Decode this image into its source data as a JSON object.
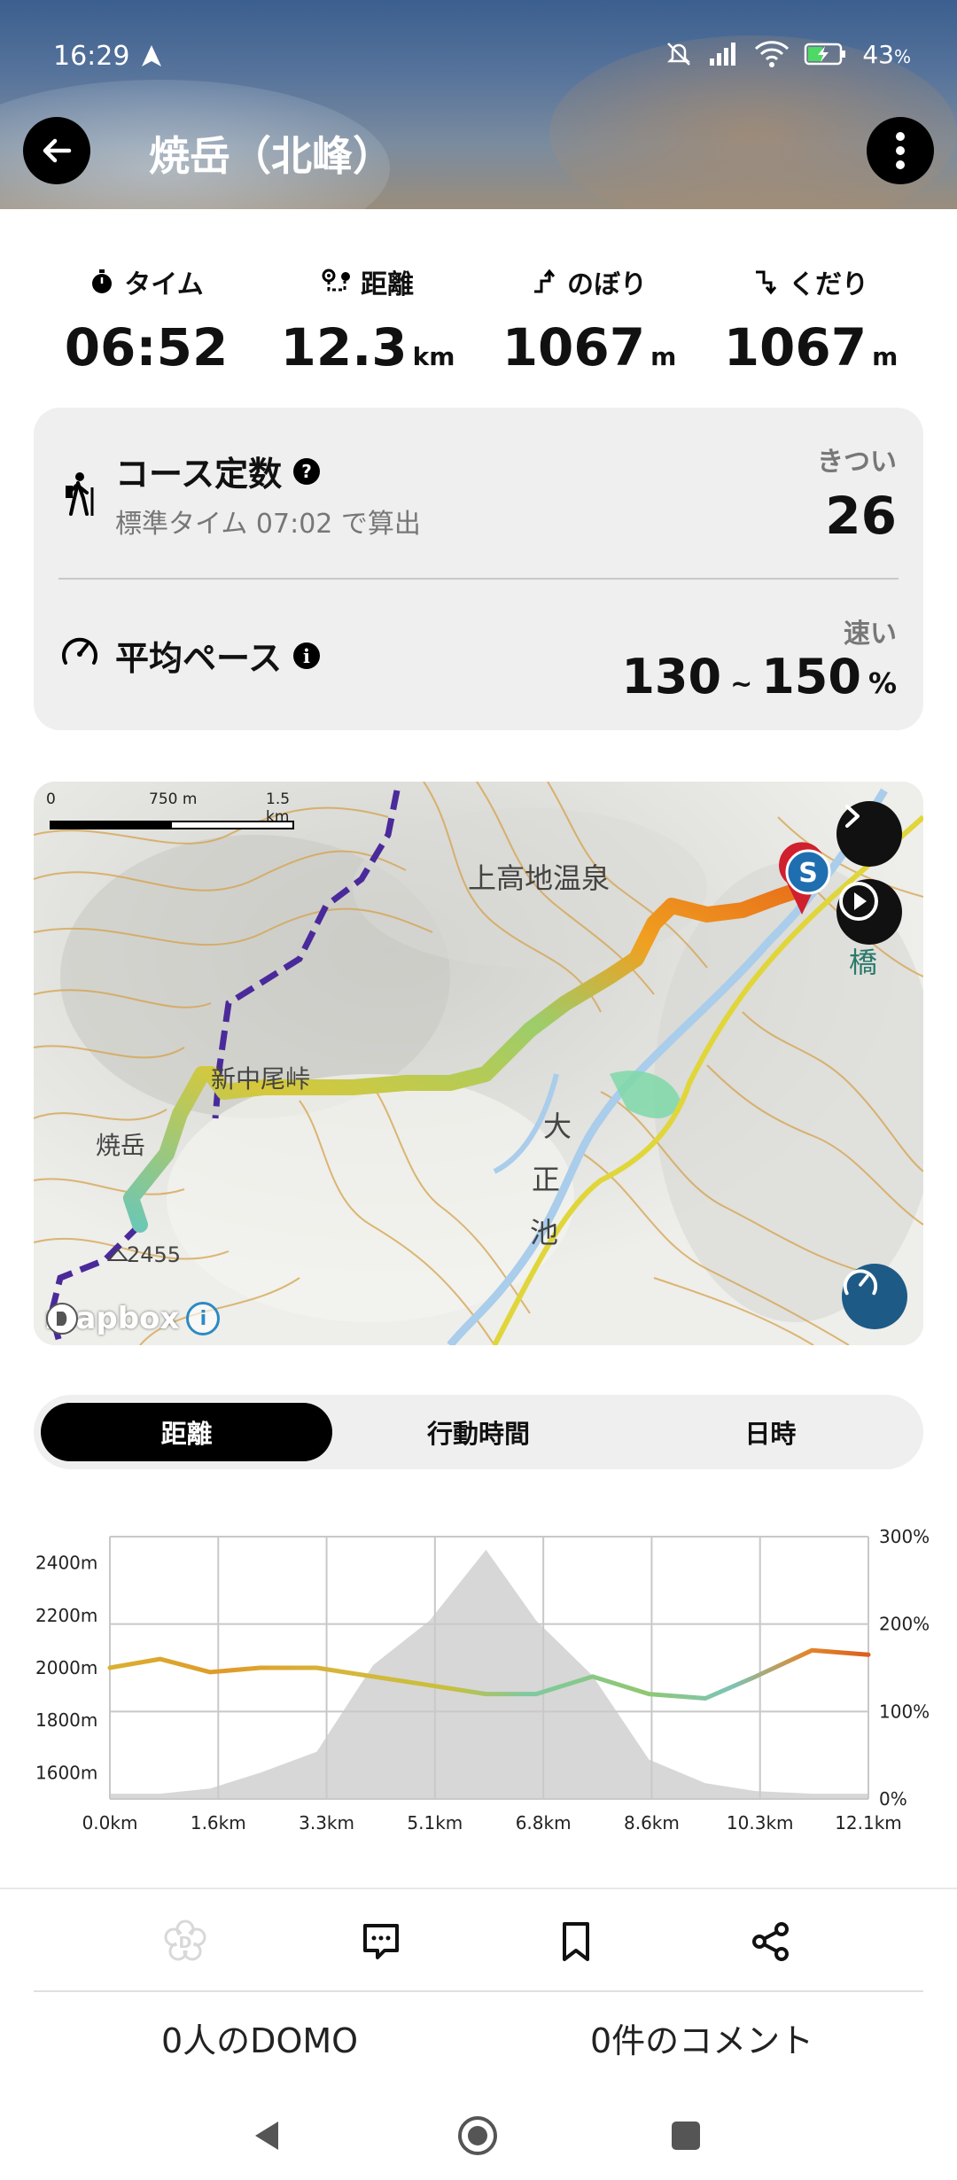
{
  "status_bar": {
    "time": "16:29",
    "battery": "43",
    "battery_unit": "%",
    "icons": [
      "navigation-arrow-icon",
      "mute-icon",
      "signal-icon",
      "wifi-icon",
      "battery-charging-icon"
    ]
  },
  "header": {
    "title": "焼岳（北峰）",
    "back_icon": "arrow-left-icon",
    "menu_icon": "more-vertical-icon"
  },
  "stats": [
    {
      "label": "タイム",
      "value": "06:52",
      "unit": "",
      "icon": "stopwatch-icon"
    },
    {
      "label": "距離",
      "value": "12.3",
      "unit": "km",
      "icon": "route-icon"
    },
    {
      "label": "のぼり",
      "value": "1067",
      "unit": "m",
      "icon": "ascent-icon"
    },
    {
      "label": "くだり",
      "value": "1067",
      "unit": "m",
      "icon": "descent-icon"
    }
  ],
  "course": {
    "title": "コース定数",
    "subtitle": "標準タイム 07:02 で算出",
    "level": "きつい",
    "value": "26",
    "icon": "hiker-icon"
  },
  "pace": {
    "title": "平均ペース",
    "speed_label": "速い",
    "min": "130",
    "separator": "~",
    "max": "150",
    "unit": "%",
    "icon": "speedometer-icon"
  },
  "map": {
    "scale_labels": [
      "0",
      "750 m",
      "1.5 km"
    ],
    "place_labels": [
      "上高地温泉",
      "新中尾峠",
      "焼岳",
      "2455",
      "大",
      "正",
      "池",
      "橋"
    ],
    "attribution": "mapbox",
    "start_marker": "S"
  },
  "tabs": [
    {
      "label": "距離",
      "active": true
    },
    {
      "label": "行動時間",
      "active": false
    },
    {
      "label": "日時",
      "active": false
    }
  ],
  "chart_data": {
    "type": "line",
    "x_tick_labels": [
      "0.0km",
      "1.6km",
      "3.3km",
      "5.1km",
      "6.8km",
      "8.6km",
      "10.3km",
      "12.1km"
    ],
    "y_left_tick_labels": [
      "2400m",
      "2200m",
      "2000m",
      "1800m",
      "1600m"
    ],
    "y_right_tick_labels": [
      "300%",
      "200%",
      "100%",
      "0%"
    ],
    "x_km": [
      0,
      0.8,
      1.6,
      2.4,
      3.3,
      4.2,
      5.1,
      6.0,
      6.8,
      7.7,
      8.6,
      9.5,
      10.3,
      11.2,
      12.1
    ],
    "series": [
      {
        "kind": "elevation-area",
        "unit": "m",
        "values": [
          1520,
          1520,
          1540,
          1600,
          1680,
          2010,
          2180,
          2450,
          2180,
          1970,
          1650,
          1560,
          1530,
          1520,
          1520
        ]
      },
      {
        "kind": "pace-line",
        "unit": "%",
        "values": [
          150,
          160,
          145,
          150,
          150,
          140,
          130,
          120,
          120,
          140,
          120,
          115,
          140,
          170,
          165
        ]
      }
    ],
    "ylim_left": [
      1500,
      2500
    ],
    "ylim_right": [
      0,
      300
    ],
    "xlim": [
      0,
      12.1
    ],
    "grid": true
  },
  "actions": {
    "items": [
      {
        "icon": "domo-flower-icon"
      },
      {
        "icon": "comment-icon"
      },
      {
        "icon": "bookmark-icon"
      },
      {
        "icon": "share-icon"
      }
    ],
    "domo_count": "0人のDOMO",
    "comment_count": "0件のコメント"
  },
  "nav": {
    "items": [
      "back-triangle-icon",
      "home-circle-icon",
      "recents-square-icon"
    ]
  }
}
